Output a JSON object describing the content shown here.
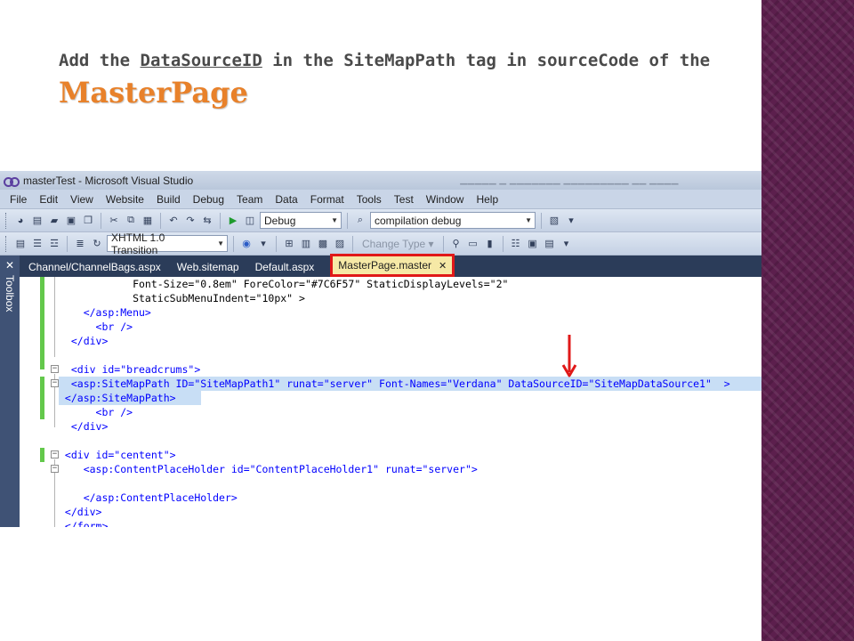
{
  "slide": {
    "title_part1": "Add the ",
    "title_underlined": "DataSourceID",
    "title_part2": " in the SiteMapPath tag in sourceCode of the",
    "title_accent": "MasterPage"
  },
  "vs": {
    "window_title": "masterTest - Microsoft Visual Studio",
    "menu": [
      "File",
      "Edit",
      "View",
      "Website",
      "Build",
      "Debug",
      "Team",
      "Data",
      "Format",
      "Tools",
      "Test",
      "Window",
      "Help"
    ],
    "toolbar1": {
      "config_combo": "Debug",
      "search_combo": "compilation debug"
    },
    "toolbar2": {
      "schema_combo": "XHTML 1.0 Transition",
      "change_type": "Change Type"
    },
    "toolbox_label": "Toolbox",
    "tabs": [
      "Channel/ChannelBags.aspx",
      "Web.sitemap",
      "Default.aspx",
      "MasterPage.master"
    ],
    "code_lines": [
      {
        "text": "            Font-Size=\"0.8em\" ForeColor=\"#7C6F57\" StaticDisplayLevels=\"2\""
      },
      {
        "text": "            StaticSubMenuIndent=\"10px\" >"
      },
      {
        "text": "    </asp:Menu>"
      },
      {
        "text": "      <br />"
      },
      {
        "text": "  </div>"
      },
      {
        "text": ""
      },
      {
        "text": "  <div id=\"breadcrums\">"
      },
      {
        "text": "  <asp:SiteMapPath ID=\"SiteMapPath1\" runat=\"server\" Font-Names=\"Verdana\" DataSourceID=\"SiteMapDataSource1\"  >"
      },
      {
        "text": " </asp:SiteMapPath>"
      },
      {
        "text": "      <br />"
      },
      {
        "text": "  </div>"
      },
      {
        "text": ""
      },
      {
        "text": " <div id=\"centent\">"
      },
      {
        "text": "    <asp:ContentPlaceHolder id=\"ContentPlaceHolder1\" runat=\"server\">"
      },
      {
        "text": ""
      },
      {
        "text": "    </asp:ContentPlaceHolder>"
      },
      {
        "text": " </div>"
      },
      {
        "text": " </form>"
      }
    ]
  }
}
